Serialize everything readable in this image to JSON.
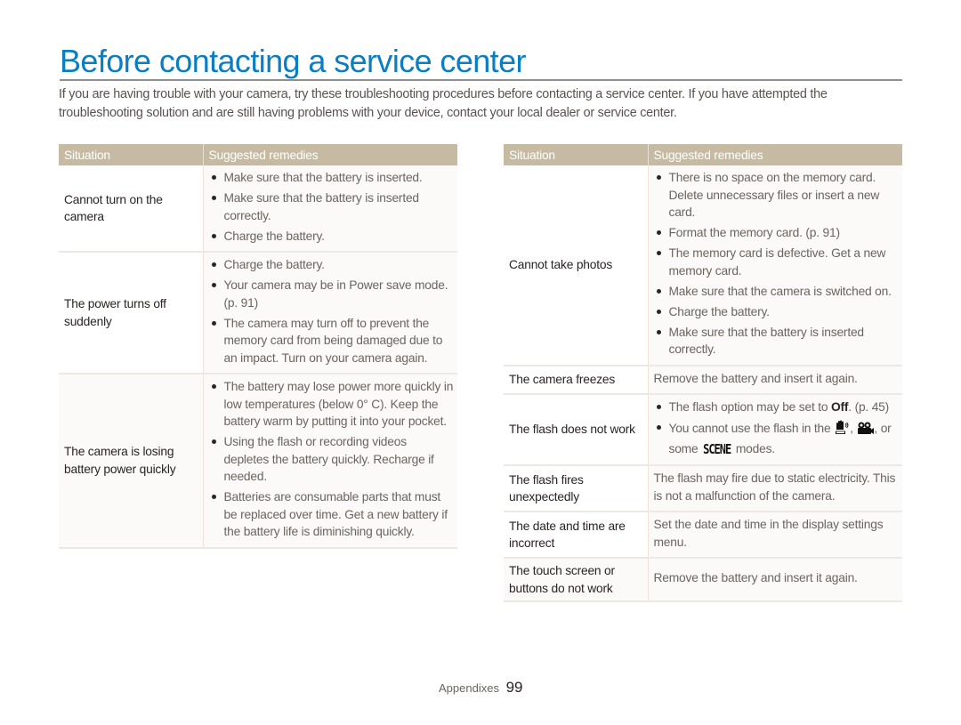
{
  "page": {
    "title": "Before contacting a service center",
    "intro": "If you are having trouble with your camera, try these troubleshooting procedures before contacting a service center. If you have attempted the troubleshooting solution and are still having problems with your device, contact your local dealer or service center.",
    "accent_color": "#0b7ec2",
    "header_color": "#c6baa2"
  },
  "left_table": {
    "headers": [
      "Situation",
      "Suggested remedies"
    ],
    "rows": [
      {
        "situation": "Cannot turn on the camera",
        "remedies": [
          "Make sure that the battery is inserted.",
          "Make sure that the battery is inserted correctly.",
          "Charge the battery."
        ]
      },
      {
        "situation": "The power turns off suddenly",
        "remedies": [
          "Charge the battery.",
          "Your camera may be in Power save mode. (p. 91)",
          "The camera may turn off to prevent the memory card from being damaged due to an impact. Turn on your camera again."
        ]
      },
      {
        "situation": "The camera is losing battery power quickly",
        "remedies": [
          "The battery may lose power more quickly in low temperatures (below 0° C). Keep the battery warm by putting it into your pocket.",
          "Using the flash or recording videos depletes the battery quickly. Recharge if needed.",
          "Batteries are consumable parts that must be replaced over time. Get a new battery if the battery life is diminishing quickly."
        ]
      }
    ]
  },
  "right_table": {
    "headers": [
      "Situation",
      "Suggested remedies"
    ],
    "rows": [
      {
        "situation": "Cannot take photos",
        "remedies": [
          "There is no space on the memory card. Delete unnecessary files or insert a new card.",
          "Format the memory card. (p. 91)",
          "The memory card is defective. Get a new memory card.",
          "Make sure that the camera is switched on.",
          "Charge the battery.",
          "Make sure that the battery is inserted correctly."
        ]
      },
      {
        "situation": "The camera freezes",
        "remedy": "Remove the battery and insert it again."
      },
      {
        "situation": "The flash does not work",
        "remedy_1_prefix": "The flash option may be set to ",
        "remedy_1_bold": "Off",
        "remedy_1_suffix": ". (p. 45)",
        "remedy_2_prefix": "You cannot use the flash in the",
        "remedy_2_icons": [
          "dual-is-icon",
          "movie-camera-icon"
        ],
        "remedy_2_mid": ", or some",
        "remedy_2_scene": "SCENE",
        "remedy_2_suffix": "modes."
      },
      {
        "situation": "The flash fires unexpectedly",
        "remedy": "The flash may fire due to static electricity. This is not a malfunction of the camera."
      },
      {
        "situation": "The date and time are incorrect",
        "remedy": "Set the date and time in the display settings menu."
      },
      {
        "situation": "The touch screen or buttons do not work",
        "remedy": "Remove the battery and insert it again."
      }
    ]
  },
  "footer": {
    "section": "Appendixes",
    "page_number": "99"
  }
}
